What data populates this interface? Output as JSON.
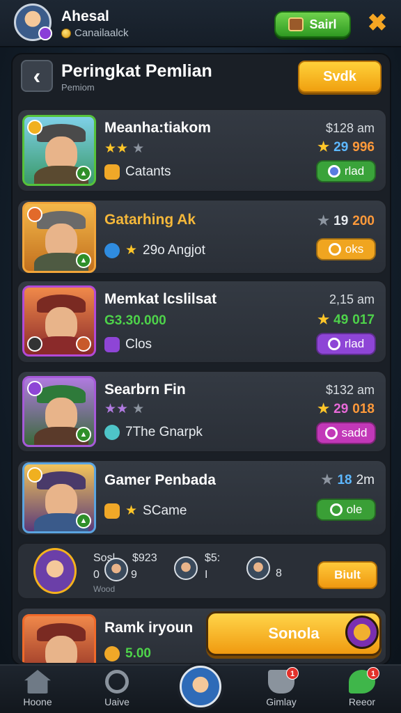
{
  "header": {
    "player_name": "Ahesal",
    "player_sub": "Canailaalck",
    "balance_button": "Sairl",
    "close_glyph": "✖"
  },
  "title_bar": {
    "title": "Peringkat Pemlian",
    "subtitle": "Pemiom",
    "sort_button": "Svdk",
    "back_glyph": "‹"
  },
  "cards": [
    {
      "name": "Meanha:tiakom",
      "rank_meta": "$128 am",
      "score_a": "29",
      "score_b": "996",
      "line3": "Catants",
      "pill": "rlad",
      "pill_color": "#3aa33a",
      "border": "#56c23a"
    },
    {
      "name": "Gatarhing Ak",
      "line2": "29o Angjot",
      "score_a": "19",
      "score_b": "200",
      "pill": "oks",
      "pill_color": "#f0a520",
      "border": "#f2a53a"
    },
    {
      "name": "Memkat lcslilsat",
      "rank_meta": "2,15 am",
      "money": "G3.30.000",
      "score_a": "49",
      "score_b": "017",
      "line3": "Clos",
      "pill": "rlad",
      "pill_color": "#8e45d6",
      "border": "#b24ad6"
    },
    {
      "name": "Searbrn Fin",
      "rank_meta": "$132 am",
      "score_a": "29",
      "score_b": "018",
      "line3": "7The Gnarpk",
      "pill": "sadd",
      "pill_color": "#c238b8",
      "border": "#a65ad8"
    },
    {
      "name": "Gamer Penbada",
      "score_a": "18",
      "score_b": "2m",
      "line3": "SCame",
      "pill": "ole",
      "pill_color": "#3a9f36",
      "border": "#5ba4e0"
    },
    {
      "name": "Ramk iryoun",
      "money": "5.00",
      "border": "#f06a2a"
    }
  ],
  "friends": {
    "t1": "Sosl",
    "t2": "$923",
    "t3": "0",
    "t4": "9",
    "t5": "$5:",
    "t6": "I",
    "t7": "8",
    "footer": "Wood",
    "button": "Biult"
  },
  "cta": {
    "label": "Sonola"
  },
  "nav": [
    {
      "label": "Hoone",
      "icon": "home-icon"
    },
    {
      "label": "Uaive",
      "icon": "target-icon"
    },
    {
      "label": "Gimlay",
      "icon": "trophy-icon",
      "badge": "1"
    },
    {
      "label": "Reeor",
      "icon": "chat-icon",
      "badge": "1"
    }
  ]
}
